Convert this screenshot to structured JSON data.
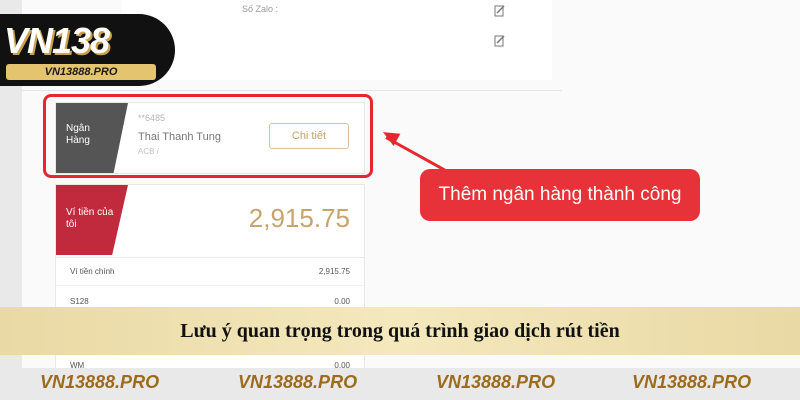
{
  "account_panel": {
    "zalo_label": "Số Zalo :"
  },
  "bank_card": {
    "tag_label": "Ngân Hàng",
    "masked_account": "**6485",
    "holder_name": "Thai Thanh Tung",
    "bank_code": "ACB /",
    "detail_button_label": "Chi tiết"
  },
  "callout": {
    "text": "Thêm ngân hàng thành công",
    "color": "#e8323a"
  },
  "wallet_card": {
    "tag_label": "Ví tiền của tôi",
    "total": "2,915.75",
    "rows": [
      {
        "label": "Ví tiền chính",
        "value": "2,915.75"
      },
      {
        "label": "S128",
        "value": "0.00"
      },
      {
        "label": "WM",
        "value": "0.00"
      }
    ]
  },
  "logo": {
    "brand": "VN138",
    "site": "VN13888.PRO"
  },
  "banner": {
    "caption": "Lưu ý quan trọng trong quá trình giao dịch rút tiền"
  },
  "footer": {
    "watermarks": [
      "VN13888.PRO",
      "VN13888.PRO",
      "VN13888.PRO",
      "VN13888.PRO"
    ]
  },
  "colors": {
    "accent_red": "#e8262f",
    "gold": "#c9a46a",
    "wallet_tag": "#c12a3c"
  }
}
